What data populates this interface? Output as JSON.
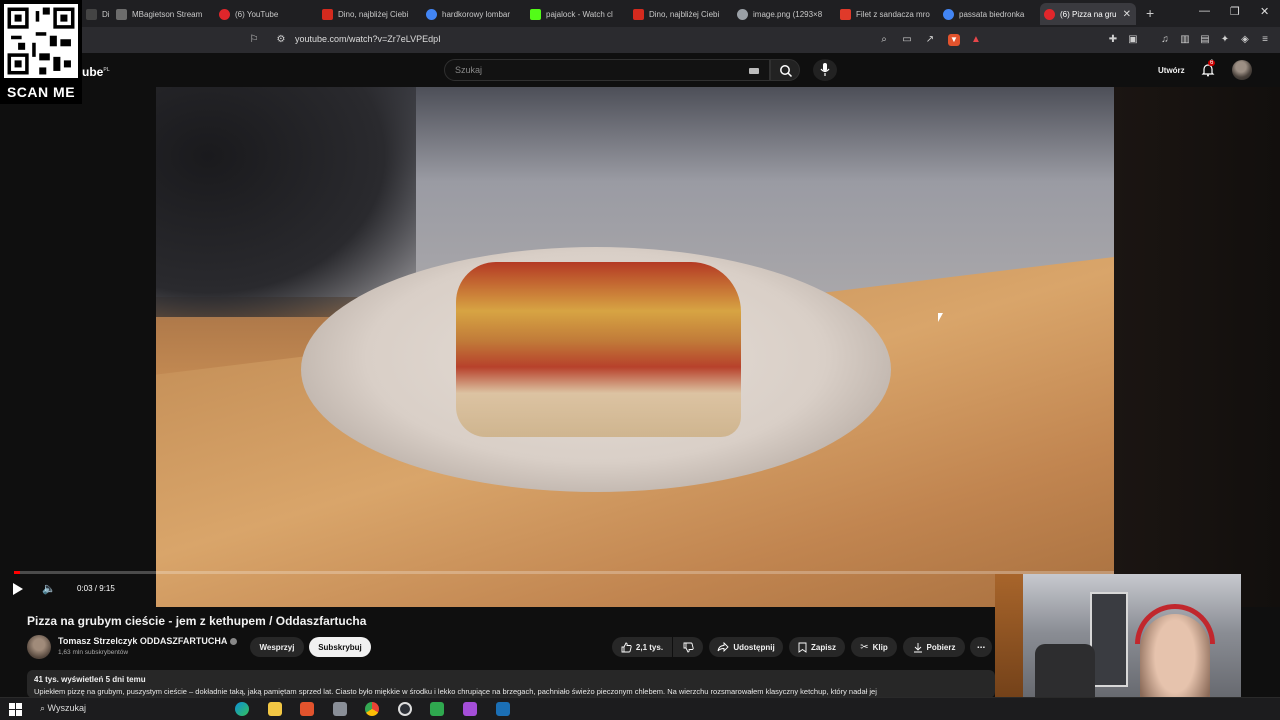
{
  "browser": {
    "tabs": [
      {
        "label": "Di",
        "favicon_color": "#444444"
      },
      {
        "label": "MBagietson Stream",
        "favicon_color": "#6c6c6c"
      },
      {
        "label": "(6) YouTube",
        "favicon_color": "#e0262b"
      },
      {
        "label": "Dino, najbliżej Ciebi",
        "favicon_color": "#d42a1e"
      },
      {
        "label": "hardkorowy lombar",
        "favicon_color": "#4285f4"
      },
      {
        "label": "pajalock - Watch cl",
        "favicon_color": "#53fc18"
      },
      {
        "label": "Dino, najbliżej Ciebi",
        "favicon_color": "#d42a1e"
      },
      {
        "label": "image.png (1293×8",
        "favicon_color": "#9aa0a6"
      },
      {
        "label": "Filet z sandacza mro",
        "favicon_color": "#e03a2a"
      },
      {
        "label": "passata biedronka",
        "favicon_color": "#4285f4"
      },
      {
        "label": "(6) Pizza na gru",
        "favicon_color": "#e0262b",
        "active": true
      }
    ],
    "new_tab": "+",
    "url": "youtube.com/watch?v=Zr7eLVPEdpI"
  },
  "youtube": {
    "logo_region": "PL",
    "search_placeholder": "Szukaj",
    "create_label": "Utwórz",
    "notifications_count": "6",
    "player": {
      "time_current": "0:03",
      "time_total": "9:15",
      "time_display": "0:03 / 9:15",
      "progress_fraction": 0.005
    },
    "video": {
      "title": "Pizza na grubym cieście - jem z kethupem / Oddaszfartucha",
      "channel_name": "Tomasz Strzelczyk ODDASZFARTUCHA",
      "subscribers": "1,63 mln subskrybentów",
      "support_label": "Wesprzyj",
      "subscribe_label": "Subskrybuj",
      "likes": "2,1 tys.",
      "share_label": "Udostępnij",
      "save_label": "Zapisz",
      "clip_label": "Klip",
      "download_label": "Pobierz",
      "more_label": "⋯",
      "views_date": "41 tys. wyświetleń  5 dni temu",
      "description_preview": "Upiekłem pizzę na grubym, puszystym cieście – dokładnie taką, jaką pamiętam sprzed lat. Ciasto było miękkie w środku i lekko chrupiące na brzegach, pachniało świeżo pieczonym chlebem. Na wierzchu rozsmarowałem klasyczny ketchup, który nadał jej"
    }
  },
  "overlay": {
    "qr_caption": "SCAN ME"
  },
  "taskbar": {
    "search_label": "Wyszukaj"
  },
  "colors": {
    "yt_red": "#ff0000",
    "background": "#0f0f0f",
    "subscribe_bg": "#f1f1f1"
  }
}
